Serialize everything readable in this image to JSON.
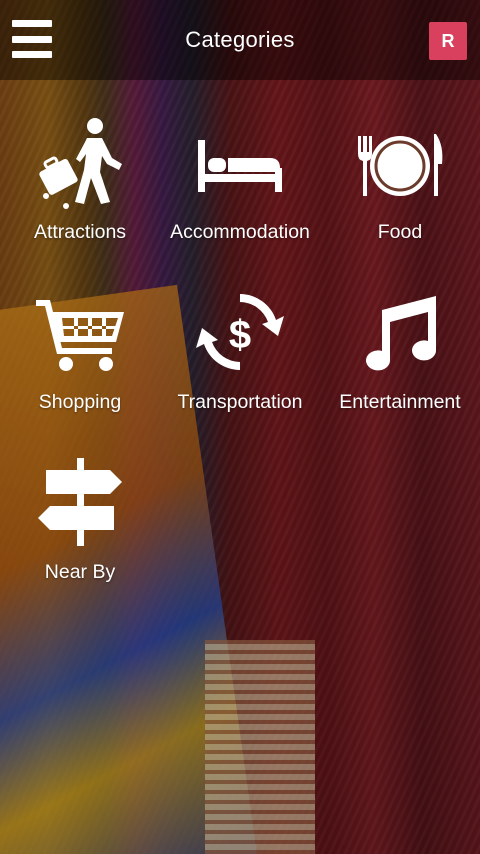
{
  "header": {
    "title": "Categories",
    "badge_label": "R",
    "menu_icon": "hamburger-menu-icon",
    "badge_color": "#d9405d"
  },
  "categories": [
    {
      "label": "Attractions",
      "icon": "traveler-luggage-icon"
    },
    {
      "label": "Accommodation",
      "icon": "bed-icon"
    },
    {
      "label": "Food",
      "icon": "plate-cutlery-icon"
    },
    {
      "label": "Shopping",
      "icon": "shopping-cart-icon"
    },
    {
      "label": "Transportation",
      "icon": "currency-exchange-icon"
    },
    {
      "label": "Entertainment",
      "icon": "music-note-icon"
    },
    {
      "label": "Near By",
      "icon": "signpost-icon"
    }
  ]
}
